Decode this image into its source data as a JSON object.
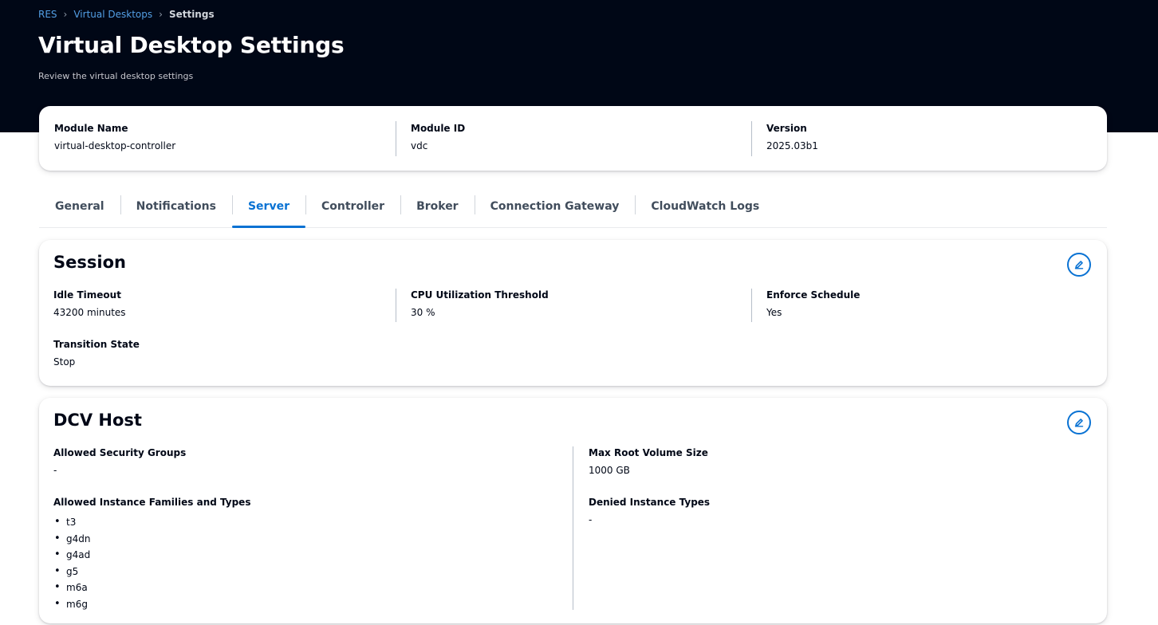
{
  "breadcrumb": {
    "items": [
      "RES",
      "Virtual Desktops"
    ],
    "current": "Settings",
    "separator": "›"
  },
  "header": {
    "title": "Virtual Desktop Settings",
    "subtitle": "Review the virtual desktop settings"
  },
  "summary": {
    "module_name_label": "Module Name",
    "module_name_value": "virtual-desktop-controller",
    "module_id_label": "Module ID",
    "module_id_value": "vdc",
    "version_label": "Version",
    "version_value": "2025.03b1"
  },
  "tabs": [
    {
      "label": "General"
    },
    {
      "label": "Notifications"
    },
    {
      "label": "Server",
      "active": true
    },
    {
      "label": "Controller"
    },
    {
      "label": "Broker"
    },
    {
      "label": "Connection Gateway"
    },
    {
      "label": "CloudWatch Logs"
    }
  ],
  "session": {
    "title": "Session",
    "idle_timeout_label": "Idle Timeout",
    "idle_timeout_value": "43200 minutes",
    "cpu_threshold_label": "CPU Utilization Threshold",
    "cpu_threshold_value": "30 %",
    "enforce_schedule_label": "Enforce Schedule",
    "enforce_schedule_value": "Yes",
    "transition_state_label": "Transition State",
    "transition_state_value": "Stop",
    "edit_icon": "pencil-icon"
  },
  "dcv_host": {
    "title": "DCV Host",
    "allowed_security_groups_label": "Allowed Security Groups",
    "allowed_security_groups_value": "-",
    "max_root_volume_label": "Max Root Volume Size",
    "max_root_volume_value": "1000 GB",
    "allowed_instances_label": "Allowed Instance Families and Types",
    "allowed_instances": [
      "t3",
      "g4dn",
      "g4ad",
      "g5",
      "m6a",
      "m6g"
    ],
    "denied_instance_types_label": "Denied Instance Types",
    "denied_instance_types_value": "-",
    "edit_icon": "pencil-icon"
  },
  "colors": {
    "header_bg": "#000716",
    "accent": "#0972d3",
    "link": "#539fe5"
  }
}
